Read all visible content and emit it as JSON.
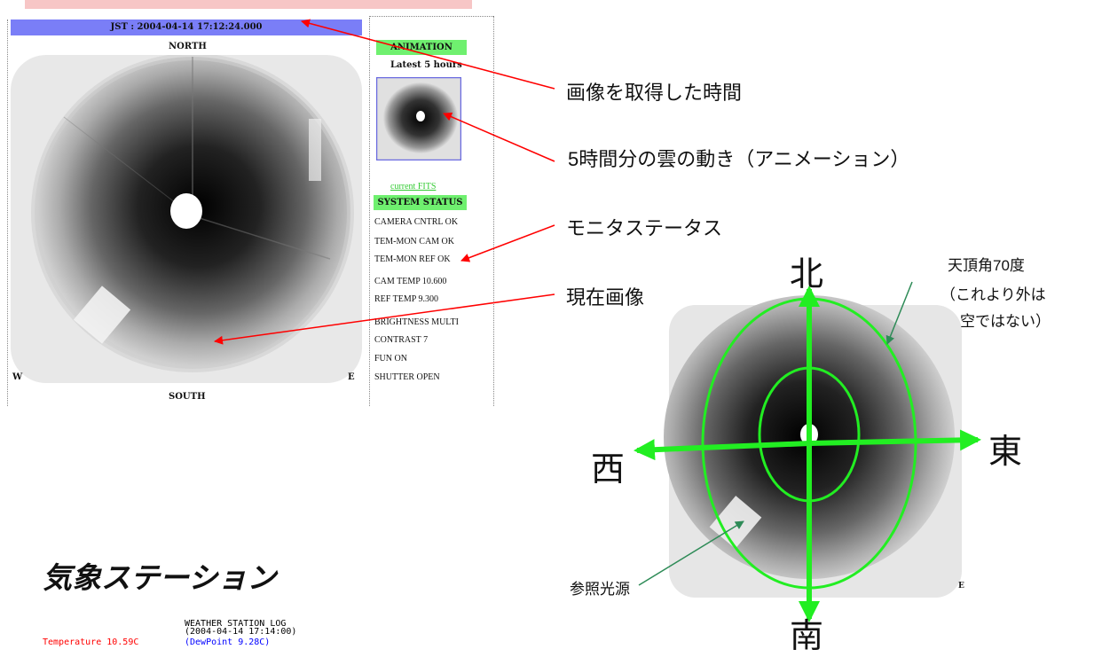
{
  "screenshot": {
    "jst_label": "JST : 2004-04-14 17:12:24.000",
    "north_label": "NORTH",
    "south_label": "SOUTH",
    "west_label": "W",
    "east_label": "E",
    "animation_heading": "ANIMATION",
    "animation_subtitle": "Latest 5 hours",
    "fits_link": "current FITS",
    "system_status_heading": "SYSTEM STATUS",
    "status_items": [
      "CAMERA CNTRL OK",
      "TEM-MON CAM OK",
      "TEM-MON REF OK",
      "CAM TEMP 10.600",
      "REF TEMP 9.300",
      "BRIGHTNESS MULTI",
      "CONTRAST 7",
      "FUN ON",
      "SHUTTER OPEN"
    ]
  },
  "annotations": {
    "image_time": "画像を取得した時間",
    "animation_desc": "5時間分の雲の動き（アニメーション）",
    "monitor_status": "モニタステータス",
    "current_image": "現在画像",
    "zenith_line1": "天頂角70度",
    "zenith_line2": "（これより外は",
    "zenith_line3": "空ではない）",
    "reference_light": "参照光源"
  },
  "compass": {
    "north": "北",
    "south": "南",
    "east": "東",
    "west": "西",
    "image_east_mark": "E",
    "arrow_color": "#22ee22"
  },
  "weather": {
    "section_title": "気象ステーション",
    "log_title": "WEATHER STATION LOG",
    "log_time": "(2004-04-14 17:14:00)",
    "temperature": "Temperature 10.59C",
    "dewpoint": "(DewPoint 9.28C)",
    "temperature_color": "#ff0000",
    "dewpoint_color": "#0000ff"
  },
  "colors": {
    "jst_bar": "#7a7ef7",
    "green_heading": "#6ff06f",
    "pointer_arrow": "#ff0000",
    "callout_line": "#2e8b57"
  }
}
